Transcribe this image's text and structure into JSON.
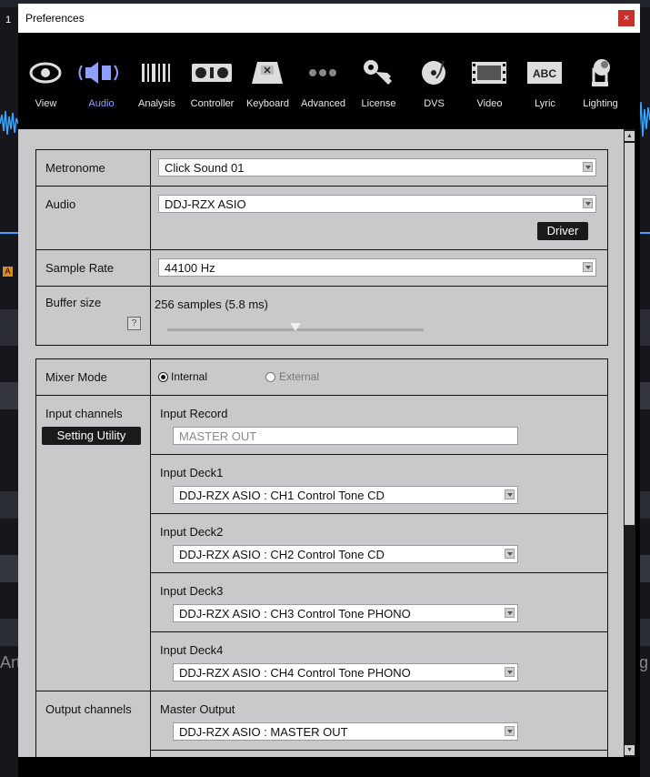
{
  "background": {
    "window_number": "1",
    "left_text": "Artv",
    "right_text": "ng"
  },
  "window": {
    "title": "Preferences",
    "close_glyph": "×"
  },
  "toolbar": {
    "items": [
      {
        "label": "View",
        "icon": "eye-icon"
      },
      {
        "label": "Audio",
        "icon": "speaker-icon"
      },
      {
        "label": "Analysis",
        "icon": "analysis-bars-icon"
      },
      {
        "label": "Controller",
        "icon": "controller-icon"
      },
      {
        "label": "Keyboard",
        "icon": "keyboard-key-icon"
      },
      {
        "label": "Advanced",
        "icon": "three-dots-icon"
      },
      {
        "label": "License",
        "icon": "key-icon"
      },
      {
        "label": "DVS",
        "icon": "turntable-icon"
      },
      {
        "label": "Video",
        "icon": "film-icon"
      },
      {
        "label": "Lyric",
        "icon": "abc-icon"
      },
      {
        "label": "Lighting",
        "icon": "moving-light-icon"
      }
    ],
    "active": "Audio",
    "active_color": "#8ea0ff"
  },
  "audio": {
    "metronome": {
      "label": "Metronome",
      "value": "Click Sound 01"
    },
    "audio": {
      "label": "Audio",
      "value": "DDJ-RZX ASIO",
      "driver_button": "Driver"
    },
    "sample_rate": {
      "label": "Sample Rate",
      "value": "44100 Hz"
    },
    "buffer": {
      "label": "Buffer size",
      "value": "256 samples (5.8 ms)",
      "help": "?",
      "slider_percent": 50
    }
  },
  "mixer": {
    "mode_label": "Mixer Mode",
    "internal_label": "Internal",
    "external_label": "External",
    "selected": "Internal",
    "input_channels_label": "Input channels",
    "setting_utility_button": "Setting Utility",
    "inputs": [
      {
        "label": "Input Record",
        "value": "MASTER OUT"
      },
      {
        "label": "Input Deck1",
        "value": "DDJ-RZX ASIO : CH1 Control Tone CD"
      },
      {
        "label": "Input Deck2",
        "value": "DDJ-RZX ASIO : CH2 Control Tone CD"
      },
      {
        "label": "Input Deck3",
        "value": "DDJ-RZX ASIO : CH3 Control Tone PHONO"
      },
      {
        "label": "Input Deck4",
        "value": "DDJ-RZX ASIO : CH4 Control Tone PHONO"
      }
    ],
    "output_channels_label": "Output channels",
    "outputs": [
      {
        "label": "Master Output",
        "value": "DDJ-RZX ASIO : MASTER OUT"
      }
    ]
  }
}
